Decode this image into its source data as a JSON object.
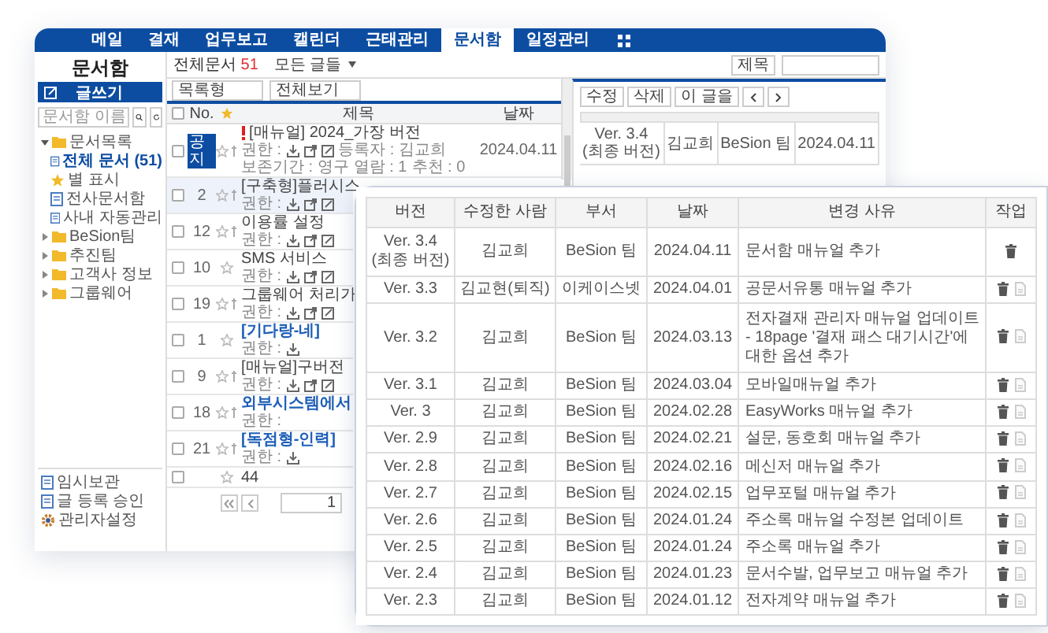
{
  "nav": {
    "items": [
      {
        "label": "메일",
        "selected": false
      },
      {
        "label": "결재",
        "selected": false
      },
      {
        "label": "업무보고",
        "selected": false
      },
      {
        "label": "캘린더",
        "selected": false
      },
      {
        "label": "근태관리",
        "selected": false
      },
      {
        "label": "문서함",
        "selected": true
      },
      {
        "label": "일정관리",
        "selected": false
      }
    ]
  },
  "sidebar": {
    "title": "문서함",
    "write_button": "글쓰기",
    "search": {
      "placeholder": "문서함 이름"
    },
    "tree": [
      {
        "label": "문서목록",
        "kind": "folder",
        "expanded": true,
        "selected": false,
        "children": [
          {
            "label": "전체 문서 (51)",
            "kind": "doc",
            "selected": true
          },
          {
            "label": "별 표시",
            "kind": "star",
            "selected": false
          },
          {
            "label": "전사문서함",
            "kind": "doc",
            "selected": false
          },
          {
            "label": "사내 자동관리",
            "kind": "doc",
            "selected": false
          }
        ]
      },
      {
        "label": "BeSion팀",
        "kind": "folder",
        "expanded": false,
        "selected": false
      },
      {
        "label": "추진팀",
        "kind": "folder",
        "expanded": false,
        "selected": false
      },
      {
        "label": "고객사 정보",
        "kind": "folder",
        "expanded": false,
        "selected": false
      },
      {
        "label": "그룹웨어",
        "kind": "folder",
        "expanded": false,
        "selected": false
      }
    ],
    "bottom_items": [
      {
        "label": "임시보관",
        "kind": "doc"
      },
      {
        "label": "글 등록 승인",
        "kind": "doc"
      },
      {
        "label": "관리자설정",
        "kind": "gear"
      }
    ]
  },
  "list": {
    "total_label": "전체문서",
    "total_count": "51",
    "scope": "모든 글들",
    "search_scope": "제목",
    "filters": [
      "목록형",
      "전체보기"
    ],
    "columns": [
      "No.",
      "제목",
      "날짜"
    ],
    "all_checked": false,
    "rows": [
      {
        "no": "공지",
        "notice": true,
        "important": true,
        "highlight": false,
        "clip": true,
        "selected": false,
        "checked": false,
        "title": "[매뉴얼] 2024_가장 버전",
        "permission": "권한 :",
        "download": true,
        "share": true,
        "edit": true,
        "details": [
          "등록자 : 김교희",
          "보존기간 : 영구",
          "열람 : 1",
          "추천 : 0"
        ],
        "date": "2024.04.11"
      },
      {
        "no": "2",
        "notice": false,
        "important": false,
        "highlight": false,
        "clip": true,
        "selected": true,
        "checked": false,
        "title": "[구축형]플러시스",
        "permission": "권한 :",
        "download": true,
        "share": true,
        "edit": true
      },
      {
        "no": "12",
        "notice": false,
        "important": false,
        "highlight": false,
        "clip": true,
        "selected": false,
        "checked": false,
        "title": "이용률 설정",
        "permission": "권한 :",
        "download": true,
        "share": true,
        "edit": true
      },
      {
        "no": "10",
        "notice": false,
        "important": false,
        "highlight": false,
        "clip": false,
        "selected": false,
        "checked": false,
        "title": "SMS 서비스",
        "permission": "권한 :",
        "download": true,
        "share": true,
        "edit": true
      },
      {
        "no": "19",
        "notice": false,
        "important": false,
        "highlight": false,
        "clip": true,
        "selected": false,
        "checked": false,
        "title": "그룹웨어 처리가",
        "permission": "권한 :",
        "download": true,
        "share": true,
        "edit": true
      },
      {
        "no": "1",
        "notice": false,
        "important": false,
        "highlight": true,
        "clip": false,
        "selected": false,
        "checked": false,
        "title": "[기다랑-네]",
        "permission": "권한 :",
        "download": true,
        "share": false,
        "edit": false
      },
      {
        "no": "9",
        "notice": false,
        "important": false,
        "highlight": false,
        "clip": true,
        "selected": false,
        "checked": false,
        "title": "[매뉴얼]구버전",
        "permission": "권한 :",
        "download": true,
        "share": true,
        "edit": true
      },
      {
        "no": "18",
        "notice": false,
        "important": false,
        "highlight": true,
        "clip": true,
        "selected": false,
        "checked": false,
        "title": "외부시스템에서",
        "permission": "권한 :",
        "download": false,
        "share": false,
        "edit": false
      },
      {
        "no": "21",
        "notice": false,
        "important": false,
        "highlight": true,
        "clip": true,
        "selected": false,
        "checked": false,
        "title": "[독점형-인력]",
        "permission": "권한 :",
        "download": true,
        "share": false,
        "edit": false
      },
      {
        "important": false,
        "highlight": false,
        "clip": false,
        "selected": false,
        "checked": false,
        "title": "44"
      }
    ],
    "pagination": {
      "page": "1"
    }
  },
  "detail": {
    "buttons": [
      "수정",
      "삭제"
    ],
    "menu": "이 글을",
    "row": {
      "version": "Ver. 3.4",
      "note": "(최종 버전)",
      "author": "김교희",
      "dept": "BeSion 팀",
      "date": "2024.04.11"
    }
  },
  "history": {
    "columns": [
      "버전",
      "수정한 사람",
      "부서",
      "날짜",
      "변경 사유",
      "작업"
    ],
    "rows": [
      {
        "version": "Ver. 3.4",
        "note": "(최종 버전)",
        "author": "김교희",
        "dept": "BeSion 팀",
        "date": "2024.04.11",
        "reason": "문서함 매뉴얼 추가",
        "file": false
      },
      {
        "version": "Ver. 3.3",
        "author": "김교현(퇴직)",
        "dept": "이케이스넷",
        "date": "2024.04.01",
        "reason": "공문서유통 매뉴얼 추가",
        "file": true
      },
      {
        "version": "Ver. 3.2",
        "author": "김교희",
        "dept": "BeSion 팀",
        "date": "2024.03.13",
        "reason": "전자결재 관리자 매뉴얼 업데이트 - 18page '결재 패스 대기시간'에 대한 옵션 추가",
        "file": true
      },
      {
        "version": "Ver. 3.1",
        "author": "김교희",
        "dept": "BeSion 팀",
        "date": "2024.03.04",
        "reason": "모바일매뉴얼 추가",
        "file": true
      },
      {
        "version": "Ver. 3",
        "author": "김교희",
        "dept": "BeSion 팀",
        "date": "2024.02.28",
        "reason": "EasyWorks 매뉴얼 추가",
        "file": true
      },
      {
        "version": "Ver. 2.9",
        "author": "김교희",
        "dept": "BeSion 팀",
        "date": "2024.02.21",
        "reason": "설문, 동호회 매뉴얼 추가",
        "file": true
      },
      {
        "version": "Ver. 2.8",
        "author": "김교희",
        "dept": "BeSion 팀",
        "date": "2024.02.16",
        "reason": "메신저 매뉴얼 추가",
        "file": true
      },
      {
        "version": "Ver. 2.7",
        "author": "김교희",
        "dept": "BeSion 팀",
        "date": "2024.02.15",
        "reason": "업무포털 매뉴얼 추가",
        "file": true
      },
      {
        "version": "Ver. 2.6",
        "author": "김교희",
        "dept": "BeSion 팀",
        "date": "2024.01.24",
        "reason": "주소록 매뉴얼 수정본 업데이트",
        "file": true
      },
      {
        "version": "Ver. 2.5",
        "author": "김교희",
        "dept": "BeSion 팀",
        "date": "2024.01.24",
        "reason": "주소록 매뉴얼 추가",
        "file": true
      },
      {
        "version": "Ver. 2.4",
        "author": "김교희",
        "dept": "BeSion 팀",
        "date": "2024.01.23",
        "reason": "문서수발, 업무보고 매뉴얼 추가",
        "file": true
      },
      {
        "version": "Ver. 2.3",
        "author": "김교희",
        "dept": "BeSion 팀",
        "date": "2024.01.12",
        "reason": "전자계약 매뉴얼 추가",
        "file": true
      }
    ]
  }
}
